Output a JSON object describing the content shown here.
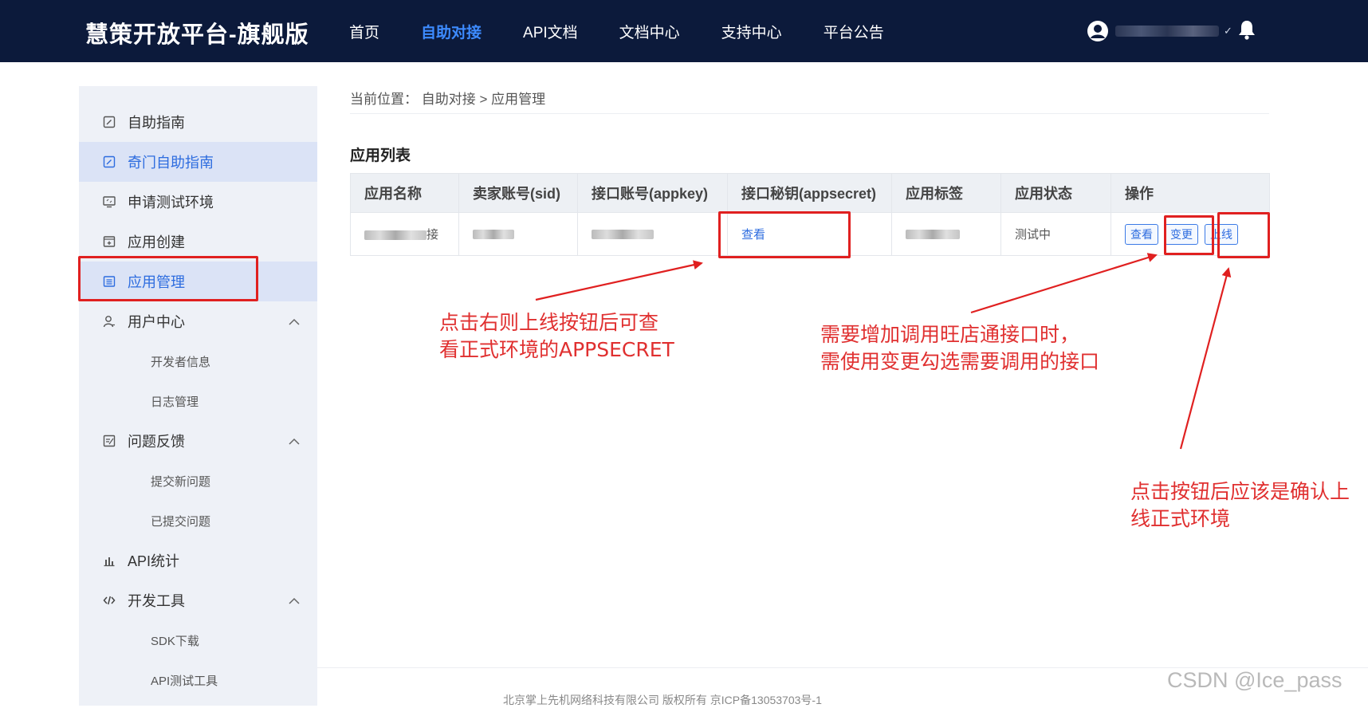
{
  "header": {
    "brand": "慧策开放平台-旗舰版",
    "nav": [
      "首页",
      "自助对接",
      "API文档",
      "文档中心",
      "支持中心",
      "平台公告"
    ],
    "active_nav": "自助对接"
  },
  "sidebar": {
    "items": [
      {
        "label": "自助指南",
        "icon": "edit-icon"
      },
      {
        "label": "奇门自助指南",
        "icon": "edit-icon"
      },
      {
        "label": "申请测试环境",
        "icon": "monitor-icon"
      },
      {
        "label": "应用创建",
        "icon": "add-window-icon"
      },
      {
        "label": "应用管理",
        "icon": "list-window-icon"
      },
      {
        "label": "用户中心",
        "icon": "user-icon"
      },
      {
        "label": "开发者信息"
      },
      {
        "label": "日志管理"
      },
      {
        "label": "问题反馈",
        "icon": "feedback-icon"
      },
      {
        "label": "提交新问题"
      },
      {
        "label": "已提交问题"
      },
      {
        "label": "API统计",
        "icon": "bar-chart-icon"
      },
      {
        "label": "开发工具",
        "icon": "code-icon"
      },
      {
        "label": "SDK下载"
      },
      {
        "label": "API测试工具"
      }
    ]
  },
  "breadcrumb": "当前位置： 自助对接 > 应用管理",
  "section_title": "应用列表",
  "table": {
    "headers": [
      "应用名称",
      "卖家账号(sid)",
      "接口账号(appkey)",
      "接口秘钥(appsecret)",
      "应用标签",
      "应用状态",
      "操作"
    ],
    "row": {
      "name_suffix": "接",
      "appsecret_link": "查看",
      "status": "测试中",
      "actions": [
        "查看",
        "变更",
        "上线"
      ]
    }
  },
  "annotations": {
    "left": [
      "点击右则上线按钮后可查",
      "看正式环境的APPSECRET"
    ],
    "middle": [
      "需要增加调用旺店通接口时，",
      "需使用变更勾选需要调用的接口"
    ],
    "right": [
      "点击按钮后应该是确认上",
      "线正式环境"
    ]
  },
  "footer": "北京掌上先机网络科技有限公司 版权所有 京ICP备13053703号-1",
  "watermark": "CSDN @Ice_pass",
  "colors": {
    "header_bg": "#0c1a3b",
    "accent": "#2d6cdf",
    "annotation_red": "#e02020",
    "sidebar_bg": "#eef1f7"
  }
}
